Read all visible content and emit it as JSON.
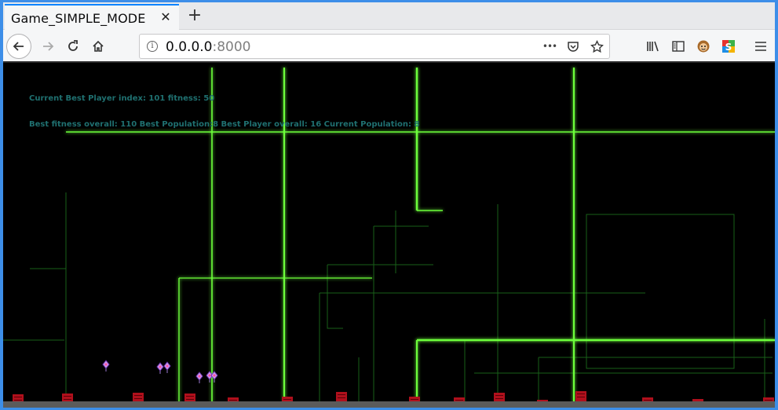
{
  "browser": {
    "tab_title": "Game_SIMPLE_MODE",
    "tab_close": "✕",
    "new_tab": "+",
    "url_host": "0.0.0.0",
    "url_port": ":8000",
    "page_actions": "•••"
  },
  "hud": {
    "current_best": "Current Best Player index: 101 fitness: 50",
    "overall": "Best fitness overall: 110 Best Population:8 Best Player overall: 16 Current Population: 8"
  },
  "colors": {
    "laser": "#6dff3a",
    "laser_dim": "#7bd46a",
    "obstacle": "#b0101c",
    "player": "#c9a0f0",
    "background": "#000000",
    "accent": "#0a84ff"
  },
  "icons": [
    "back-icon",
    "forward-icon",
    "reload-icon",
    "home-icon",
    "info-icon",
    "page-actions-icon",
    "pocket-icon",
    "bookmark-star-icon",
    "library-icon",
    "sidebar-icon",
    "extension-monkey-icon",
    "extension-s-icon",
    "hamburger-menu-icon"
  ]
}
